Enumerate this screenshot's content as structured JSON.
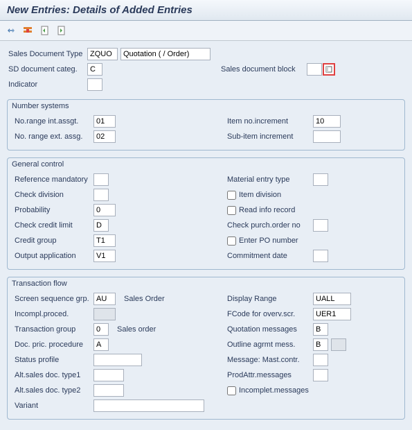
{
  "header": {
    "title": "New Entries: Details of Added Entries"
  },
  "top": {
    "sales_doc_type_lbl": "Sales Document Type",
    "sales_doc_type": "ZQUO",
    "sales_doc_type_desc": "Quotation ( / Order)",
    "sd_doc_categ_lbl": "SD document categ.",
    "sd_doc_categ": "C",
    "sales_doc_block_lbl": "Sales document block",
    "sales_doc_block": "",
    "indicator_lbl": "Indicator",
    "indicator": ""
  },
  "number_systems": {
    "title": "Number systems",
    "no_range_int_lbl": "No.range int.assgt.",
    "no_range_int": "01",
    "item_no_incr_lbl": "Item no.increment",
    "item_no_incr": "10",
    "no_range_ext_lbl": "No. range ext. assg.",
    "no_range_ext": "02",
    "sub_item_incr_lbl": "Sub-item increment",
    "sub_item_incr": ""
  },
  "general_control": {
    "title": "General control",
    "ref_mandatory_lbl": "Reference mandatory",
    "ref_mandatory": "",
    "material_entry_lbl": "Material entry type",
    "material_entry": "",
    "check_division_lbl": "Check division",
    "check_division": "",
    "item_division_lbl": "Item division",
    "probability_lbl": "Probability",
    "probability": "0",
    "read_info_lbl": "Read info record",
    "check_credit_lbl": "Check credit limit",
    "check_credit": "D",
    "check_po_lbl": "Check purch.order no",
    "check_po": "",
    "credit_group_lbl": "Credit group",
    "credit_group": "T1",
    "enter_po_lbl": "Enter PO number",
    "output_app_lbl": "Output application",
    "output_app": "V1",
    "commitment_lbl": "Commitment  date",
    "commitment": ""
  },
  "transaction_flow": {
    "title": "Transaction flow",
    "screen_seq_lbl": "Screen sequence grp.",
    "screen_seq": "AU",
    "screen_seq_desc": "Sales Order",
    "display_range_lbl": "Display Range",
    "display_range": "UALL",
    "incompl_proced_lbl": "Incompl.proced.",
    "incompl_proced": "",
    "fcode_lbl": "FCode for overv.scr.",
    "fcode": "UER1",
    "trans_group_lbl": "Transaction group",
    "trans_group": "0",
    "trans_group_desc": "Sales order",
    "quot_msg_lbl": "Quotation messages",
    "quot_msg": "B",
    "doc_pric_lbl": "Doc. pric. procedure",
    "doc_pric": "A",
    "outline_lbl": "Outline agrmt mess.",
    "outline": "B",
    "status_profile_lbl": "Status profile",
    "status_profile": "",
    "msg_mast_lbl": "Message: Mast.contr.",
    "msg_mast": "",
    "alt1_lbl": "Alt.sales doc. type1",
    "alt1": "",
    "prodattr_lbl": "ProdAttr.messages",
    "prodattr": "",
    "alt2_lbl": "Alt.sales doc. type2",
    "alt2": "",
    "incomplet_lbl": "Incomplet.messages",
    "variant_lbl": "Variant",
    "variant": ""
  }
}
